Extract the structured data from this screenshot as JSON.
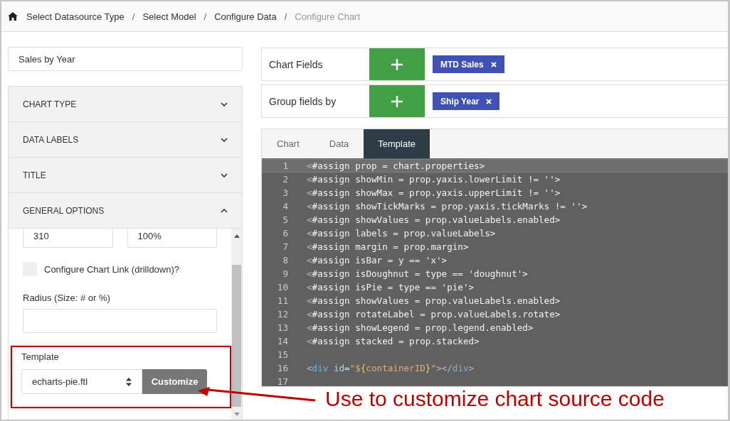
{
  "breadcrumb": {
    "separator": "/",
    "items": [
      {
        "label": "Select Datasource Type",
        "current": false
      },
      {
        "label": "Select Model",
        "current": false
      },
      {
        "label": "Configure Data",
        "current": false
      },
      {
        "label": "Configure Chart",
        "current": true
      }
    ]
  },
  "chart_name": {
    "value": "Sales by Year"
  },
  "accordion": [
    {
      "label": "CHART TYPE",
      "expanded": false
    },
    {
      "label": "DATA LABELS",
      "expanded": false
    },
    {
      "label": "TITLE",
      "expanded": false
    },
    {
      "label": "GENERAL OPTIONS",
      "expanded": true
    }
  ],
  "general_options": {
    "size_inputs": [
      "310",
      "100%"
    ],
    "drilldown": {
      "label": "Configure Chart Link (drilldown)?",
      "checked": false
    },
    "radius": {
      "label": "Radius (Size: # or %)"
    },
    "template": {
      "label": "Template",
      "value": "echarts-pie.ftl",
      "button": "Customize"
    }
  },
  "field_rows": [
    {
      "label": "Chart Fields",
      "tags": [
        "MTD Sales"
      ]
    },
    {
      "label": "Group fields by",
      "tags": [
        "Ship Year"
      ]
    }
  ],
  "tabs": [
    {
      "label": "Chart",
      "selected": false
    },
    {
      "label": "Data",
      "selected": false
    },
    {
      "label": "Template",
      "selected": true
    }
  ],
  "code_lines": [
    {
      "number": "1",
      "active": true,
      "tokens": [
        {
          "kind": "punct",
          "text": "<"
        },
        {
          "kind": "plain",
          "text": "#assign prop = chart.properties>"
        }
      ]
    },
    {
      "number": "2",
      "active": false,
      "tokens": [
        {
          "kind": "punct",
          "text": "<"
        },
        {
          "kind": "plain",
          "text": "#assign showMin = prop.yaxis.lowerLimit != ''>"
        }
      ]
    },
    {
      "number": "3",
      "active": false,
      "tokens": [
        {
          "kind": "punct",
          "text": "<"
        },
        {
          "kind": "plain",
          "text": "#assign showMax = prop.yaxis.upperLimit != ''>"
        }
      ]
    },
    {
      "number": "4",
      "active": false,
      "tokens": [
        {
          "kind": "punct",
          "text": "<"
        },
        {
          "kind": "plain",
          "text": "#assign showTickMarks = prop.yaxis.tickMarks != ''>"
        }
      ]
    },
    {
      "number": "5",
      "active": false,
      "tokens": [
        {
          "kind": "punct",
          "text": "<"
        },
        {
          "kind": "plain",
          "text": "#assign showValues = prop.valueLabels.enabled>"
        }
      ]
    },
    {
      "number": "6",
      "active": false,
      "tokens": [
        {
          "kind": "punct",
          "text": "<"
        },
        {
          "kind": "plain",
          "text": "#assign labels = prop.valueLabels>"
        }
      ]
    },
    {
      "number": "7",
      "active": false,
      "tokens": [
        {
          "kind": "punct",
          "text": "<"
        },
        {
          "kind": "plain",
          "text": "#assign margin = prop.margin>"
        }
      ]
    },
    {
      "number": "8",
      "active": false,
      "tokens": [
        {
          "kind": "punct",
          "text": "<"
        },
        {
          "kind": "plain",
          "text": "#assign isBar = y == 'x'>"
        }
      ]
    },
    {
      "number": "9",
      "active": false,
      "tokens": [
        {
          "kind": "punct",
          "text": "<"
        },
        {
          "kind": "plain",
          "text": "#assign isDoughnut = type == 'doughnut'>"
        }
      ]
    },
    {
      "number": "10",
      "active": false,
      "tokens": [
        {
          "kind": "punct",
          "text": "<"
        },
        {
          "kind": "plain",
          "text": "#assign isPie = type == 'pie'>"
        }
      ]
    },
    {
      "number": "11",
      "active": false,
      "tokens": [
        {
          "kind": "punct",
          "text": "<"
        },
        {
          "kind": "plain",
          "text": "#assign showValues = prop.valueLabels.enabled>"
        }
      ]
    },
    {
      "number": "12",
      "active": false,
      "tokens": [
        {
          "kind": "punct",
          "text": "<"
        },
        {
          "kind": "plain",
          "text": "#assign rotateLabel = prop.valueLabels.rotate>"
        }
      ]
    },
    {
      "number": "13",
      "active": false,
      "tokens": [
        {
          "kind": "punct",
          "text": "<"
        },
        {
          "kind": "plain",
          "text": "#assign showLegend = prop.legend.enabled>"
        }
      ]
    },
    {
      "number": "14",
      "active": false,
      "tokens": [
        {
          "kind": "punct",
          "text": "<"
        },
        {
          "kind": "plain",
          "text": "#assign stacked = prop.stacked>"
        }
      ]
    },
    {
      "number": "15",
      "active": false
    },
    {
      "number": "16",
      "active": false,
      "tokens": [
        {
          "kind": "punct",
          "text": "<"
        },
        {
          "kind": "tag",
          "text": "div"
        },
        {
          "kind": "attr",
          "text": " id"
        },
        {
          "kind": "plain",
          "text": "="
        },
        {
          "kind": "string",
          "text": "\"$"
        },
        {
          "kind": "brace",
          "text": "{"
        },
        {
          "kind": "string",
          "text": "containerID"
        },
        {
          "kind": "brace",
          "text": "}"
        },
        {
          "kind": "string",
          "text": "\""
        },
        {
          "kind": "punct",
          "text": "></"
        },
        {
          "kind": "tag",
          "text": "div"
        },
        {
          "kind": "punct",
          "text": ">"
        }
      ]
    },
    {
      "number": "17",
      "active": false
    }
  ],
  "annotation": {
    "text": "Use to customize chart source code"
  }
}
